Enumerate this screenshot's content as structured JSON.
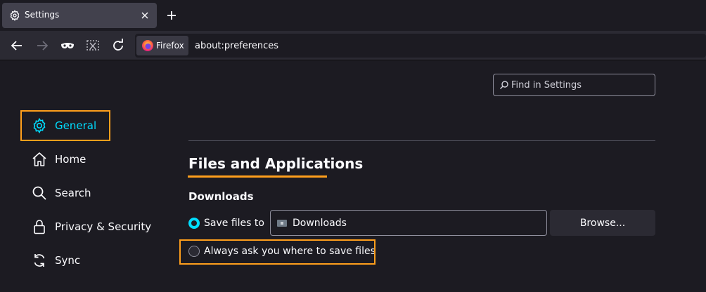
{
  "tab": {
    "title": "Settings",
    "icon": "gear-icon",
    "close_icon": "close-icon"
  },
  "newtab_icon": "plus-icon",
  "nav": {
    "back_icon": "back-arrow-icon",
    "forward_icon": "forward-arrow-icon",
    "private_icon": "mask-icon",
    "screenshot_icon": "screenshot-icon",
    "reload_icon": "reload-icon"
  },
  "urlbar": {
    "identity_label": "Firefox",
    "url": "about:preferences"
  },
  "search": {
    "placeholder": "Find in Settings"
  },
  "categories": [
    {
      "label": "General",
      "icon": "gear-icon",
      "selected": true
    },
    {
      "label": "Home",
      "icon": "home-icon",
      "selected": false
    },
    {
      "label": "Search",
      "icon": "search-icon",
      "selected": false
    },
    {
      "label": "Privacy & Security",
      "icon": "lock-icon",
      "selected": false
    },
    {
      "label": "Sync",
      "icon": "sync-icon",
      "selected": false
    }
  ],
  "section": {
    "title": "Files and Applications",
    "downloads_heading": "Downloads",
    "save_files_label": "Save files to",
    "save_folder": "Downloads",
    "browse_label": "Browse...",
    "always_ask_label": "Always ask you where to save files",
    "save_files_selected": true
  },
  "colors": {
    "accent": "#00ddff",
    "highlight": "#ff9f1c",
    "background": "#1c1b22",
    "toolbar": "#2b2a33"
  }
}
